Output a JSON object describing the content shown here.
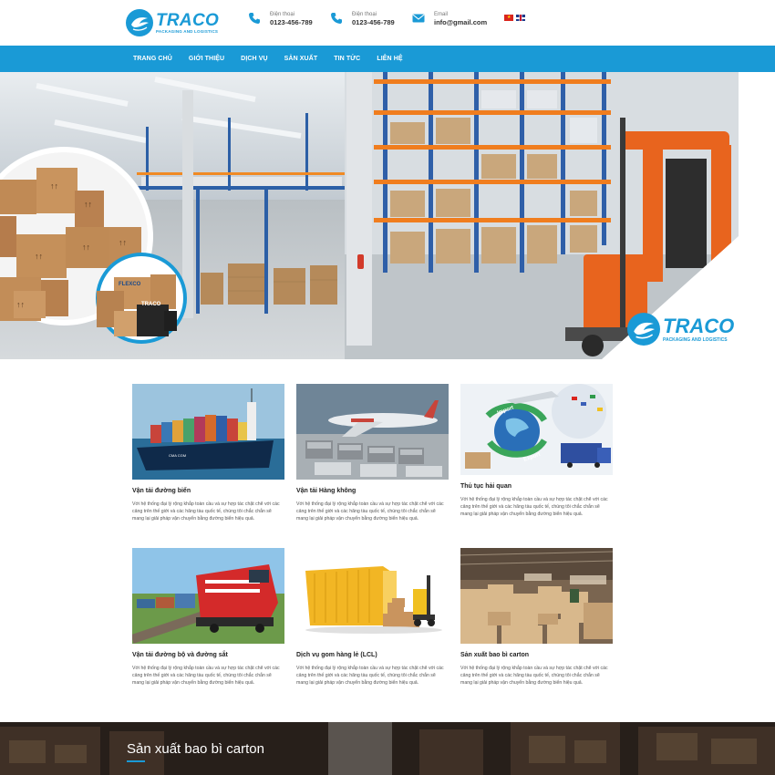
{
  "brand": {
    "name": "TRACO",
    "tagline": "PACKAGING AND LOGISTICS",
    "accent_color": "#1a9ad6"
  },
  "header": {
    "contacts": [
      {
        "icon": "phone-icon",
        "label": "Điện thoại",
        "value": "0123-456-789"
      },
      {
        "icon": "phone-icon",
        "label": "Điện thoại",
        "value": "0123-456-789"
      },
      {
        "icon": "mail-icon",
        "label": "Email",
        "value": "info@gmail.com"
      }
    ],
    "languages": [
      "vn-flag-icon",
      "uk-flag-icon"
    ]
  },
  "nav": {
    "items": [
      "TRANG CHỦ",
      "GIỚI THIỆU",
      "DỊCH VỤ",
      "SẢN XUẤT",
      "TIN TỨC",
      "LIÊN HỆ"
    ]
  },
  "services": [
    {
      "title": "Vận tải đường biển",
      "desc": "Với hệ thống đại lý rộng khắp toàn cầu và sự hợp tác chặt chẽ với các cảng trên thế giới và các hãng tàu quốc tế, chúng tôi chắc chắn sẽ mang lại giải pháp vận chuyển bằng đường biển hiệu quả."
    },
    {
      "title": "Vận tải Hàng không",
      "desc": "Với hệ thống đại lý rộng khắp toàn cầu và sự hợp tác chặt chẽ với các cảng trên thế giới và các hãng tàu quốc tế, chúng tôi chắc chắn sẽ mang lại giải pháp vận chuyển bằng đường biển hiệu quả."
    },
    {
      "title": "Thủ tục hải quan",
      "desc": "Với hệ thống đại lý rộng khắp toàn cầu và sự hợp tác chặt chẽ với các cảng trên thế giới và các hãng tàu quốc tế, chúng tôi chắc chắn sẽ mang lại giải pháp vận chuyển bằng đường biển hiệu quả."
    },
    {
      "title": "Vận tải đường bộ và đường sắt",
      "desc": "Với hệ thống đại lý rộng khắp toàn cầu và sự hợp tác chặt chẽ với các cảng trên thế giới và các hãng tàu quốc tế, chúng tôi chắc chắn sẽ mang lại giải pháp vận chuyển bằng đường biển hiệu quả."
    },
    {
      "title": "Dịch vụ gom hàng lẻ (LCL)",
      "desc": "Với hệ thống đại lý rộng khắp toàn cầu và sự hợp tác chặt chẽ với các cảng trên thế giới và các hãng tàu quốc tế, chúng tôi chắc chắn sẽ mang lại giải pháp vận chuyển bằng đường biển hiệu quả."
    },
    {
      "title": "Sản xuất bao bì carton",
      "desc": "Với hệ thống đại lý rộng khắp toàn cầu và sự hợp tác chặt chẽ với các cảng trên thế giới và các hãng tàu quốc tế, chúng tôi chắc chắn sẽ mang lại giải pháp vận chuyển bằng đường biển hiệu quả."
    }
  ],
  "import_export": {
    "import": "Import",
    "export": "Export"
  },
  "banner": {
    "title": "Sản xuất bao bì carton"
  }
}
